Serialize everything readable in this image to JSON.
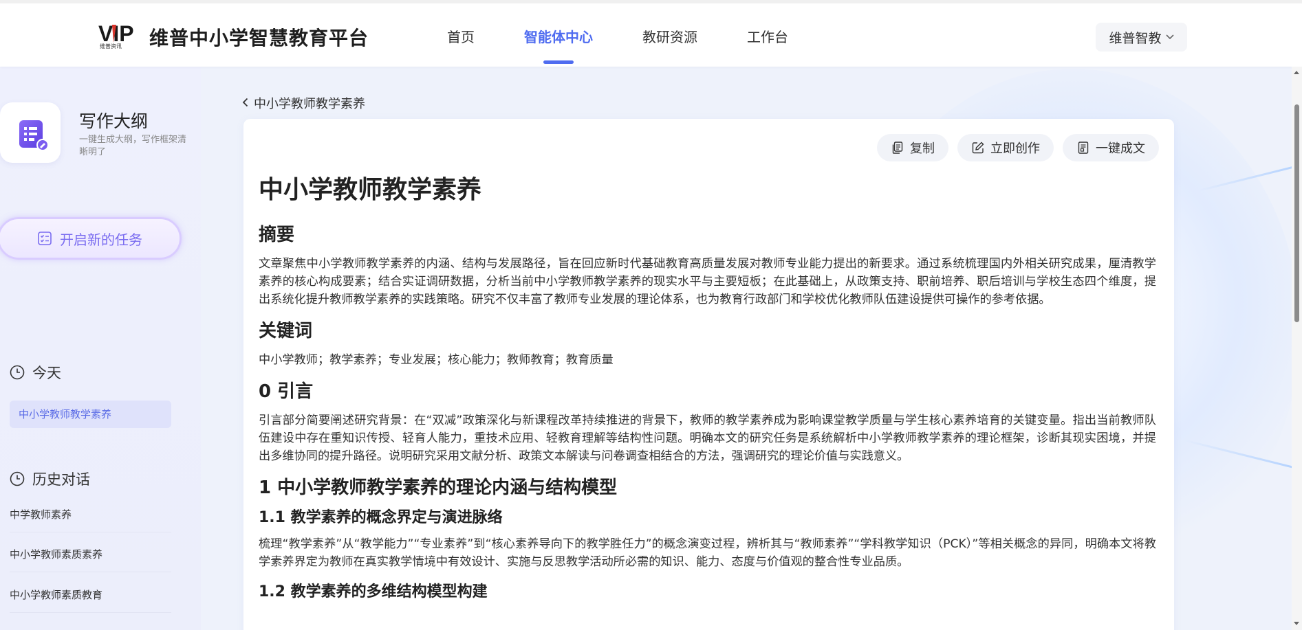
{
  "brand": {
    "logo_text": "VIP",
    "logo_subtext": "维普资讯",
    "title": "维普中小学智慧教育平台"
  },
  "nav": {
    "items": [
      {
        "label": "首页",
        "active": false
      },
      {
        "label": "智能体中心",
        "active": true
      },
      {
        "label": "教研资源",
        "active": false
      },
      {
        "label": "工作台",
        "active": false
      }
    ],
    "user_label": "维普智教"
  },
  "sidebar": {
    "agent_name": "写作大纲",
    "agent_desc": "一键生成大纲，写作框架清晰明了",
    "new_task_label": "开启新的任务",
    "today_label": "今天",
    "today_items": [
      "中小学教师教学素养"
    ],
    "history_label": "历史对话",
    "history_items": [
      "中学教师素养",
      "中小学教师素质素养",
      "中小学教师素质教育"
    ]
  },
  "main": {
    "back_label": "中小学教师教学素养",
    "actions": {
      "copy": "复制",
      "create": "立即创作",
      "oneclick": "一键成文"
    },
    "doc": {
      "title": "中小学教师教学素养",
      "abstract_heading": "摘要",
      "abstract_text": "文章聚焦中小学教师教学素养的内涵、结构与发展路径，旨在回应新时代基础教育高质量发展对教师专业能力提出的新要求。通过系统梳理国内外相关研究成果，厘清教学素养的核心构成要素；结合实证调研数据，分析当前中小学教师教学素养的现实水平与主要短板；在此基础上，从政策支持、职前培养、职后培训与学校生态四个维度，提出系统化提升教师教学素养的实践策略。研究不仅丰富了教师专业发展的理论体系，也为教育行政部门和学校优化教师队伍建设提供可操作的参考依据。",
      "keywords_heading": "关键词",
      "keywords_text": "中小学教师；教学素养；专业发展；核心能力；教师教育；教育质量",
      "intro_heading": "0 引言",
      "intro_text": "引言部分简要阐述研究背景：在“双减”政策深化与新课程改革持续推进的背景下，教师的教学素养成为影响课堂教学质量与学生核心素养培育的关键变量。指出当前教师队伍建设中存在重知识传授、轻育人能力，重技术应用、轻教育理解等结构性问题。明确本文的研究任务是系统解析中小学教师教学素养的理论框架，诊断其现实困境，并提出多维协同的提升路径。说明研究采用文献分析、政策文本解读与问卷调查相结合的方法，强调研究的理论价值与实践意义。",
      "sec1_heading": "1 中小学教师教学素养的理论内涵与结构模型",
      "sec11_heading": "1.1 教学素养的概念界定与演进脉络",
      "sec11_text": "梳理“教学素养”从“教学能力”“专业素养”到“核心素养导向下的教学胜任力”的概念演变过程，辨析其与“教师素养”“学科教学知识（PCK）”等相关概念的异同，明确本文将教学素养界定为教师在真实教学情境中有效设计、实施与反思教学活动所必需的知识、能力、态度与价值观的整合性专业品质。",
      "sec12_heading": "1.2 教学素养的多维结构模型构建"
    }
  },
  "colors": {
    "accent": "#4f6cf0",
    "new_task_text": "#7a6cf0",
    "today_item_bg": "#dfe2fb"
  }
}
